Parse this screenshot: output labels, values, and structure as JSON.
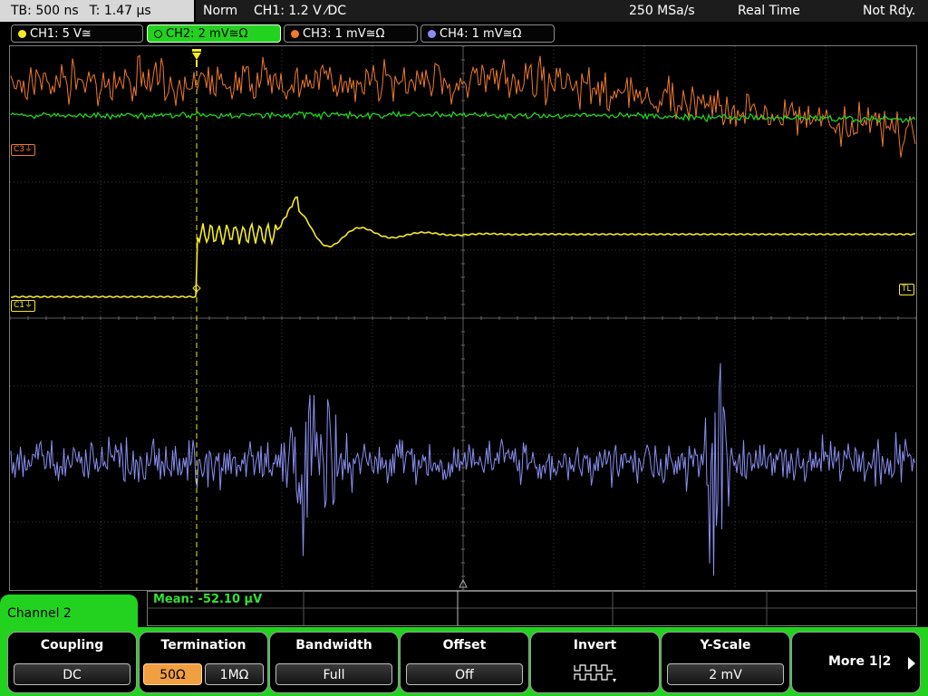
{
  "top": {
    "timebase": "TB: 500 ns",
    "trigger_time": "T: 1.47 µs",
    "mode": "Norm",
    "trigger_setting": "CH1: 1.2 V ⁄DC",
    "sample_rate": "250 MSa/s",
    "acq_mode": "Real Time",
    "status": "Not Rdy."
  },
  "channels": [
    {
      "label": "CH1: 5 V≅",
      "color": "#f5ea2a",
      "active": false
    },
    {
      "label": "CH2: 2 mV≅Ω",
      "color": "#23d21f",
      "active": true
    },
    {
      "label": "CH3: 1 mV≅Ω",
      "color": "#f07a2a",
      "active": false
    },
    {
      "label": "CH4: 1 mV≅Ω",
      "color": "#8a8ef0",
      "active": false
    }
  ],
  "markers": {
    "c3": "C3",
    "c1": "C1",
    "tl": "TL"
  },
  "measurement": "Mean: -52.10 µV",
  "menu": {
    "tab": "Channel 2",
    "coupling": {
      "title": "Coupling",
      "value": "DC"
    },
    "termination": {
      "title": "Termination",
      "opt1": "50Ω",
      "opt2": "1MΩ"
    },
    "bandwidth": {
      "title": "Bandwidth",
      "value": "Full"
    },
    "offset": {
      "title": "Offset",
      "value": "Off"
    },
    "invert": {
      "title": "Invert"
    },
    "yscale": {
      "title": "Y-Scale",
      "value": "2 mV"
    },
    "more": "More 1|2"
  }
}
